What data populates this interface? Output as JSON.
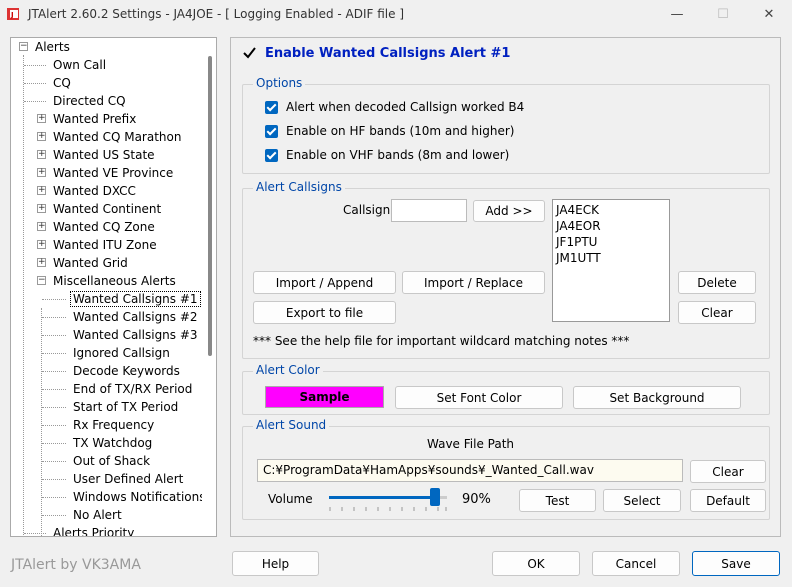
{
  "window": {
    "title": "JTAlert 2.60.2 Settings  -  JA4JOE  -  [ Logging Enabled - ADIF file ]",
    "minimize": "—",
    "maximize": "☐",
    "close": "✕"
  },
  "tree": {
    "root": "Alerts",
    "items": [
      "Own Call",
      "CQ",
      "Directed CQ",
      "Wanted Prefix",
      "Wanted CQ Marathon",
      "Wanted US State",
      "Wanted VE Province",
      "Wanted DXCC",
      "Wanted Continent",
      "Wanted CQ Zone",
      "Wanted ITU Zone",
      "Wanted Grid",
      "Miscellaneous Alerts",
      "Wanted Callsigns #1",
      "Wanted Callsigns #2",
      "Wanted Callsigns #3",
      "Ignored Callsign",
      "Decode Keywords",
      "End of TX/RX Period",
      "Start of TX Period",
      "Rx Frequency",
      "TX Watchdog",
      "Out of Shack",
      "User Defined Alert",
      "Windows Notifications",
      "No Alert",
      "Alerts Priority"
    ]
  },
  "panel": {
    "enable_label": "Enable Wanted Callsigns Alert #1",
    "options": {
      "title": "Options",
      "items": [
        "Alert when decoded Callsign worked B4",
        "Enable on HF bands (10m and higher)",
        "Enable on VHF bands (8m and lower)"
      ]
    },
    "callsigns": {
      "title": "Alert Callsigns",
      "callsign_label": "Callsign",
      "callsign_value": "",
      "add_label": "Add >>",
      "list": [
        "JA4ECK",
        "JA4EOR",
        "JF1PTU",
        "JM1UTT"
      ],
      "import_append": "Import / Append",
      "import_replace": "Import / Replace",
      "export": "Export to file",
      "delete": "Delete",
      "clear": "Clear",
      "note": "***  See the help file for important wildcard matching notes  ***"
    },
    "color": {
      "title": "Alert Color",
      "sample": "Sample",
      "sample_bg": "#ff00ff",
      "set_font": "Set Font Color",
      "set_bg": "Set Background"
    },
    "sound": {
      "title": "Alert Sound",
      "path_label": "Wave File Path",
      "path_value": "C:¥ProgramData¥HamApps¥sounds¥_Wanted_Call.wav",
      "clear": "Clear",
      "volume_label": "Volume",
      "volume_value": "90%",
      "volume_fraction": 0.9,
      "test": "Test",
      "select": "Select",
      "default": "Default"
    }
  },
  "footer": {
    "brand": "JTAlert by VK3AMA",
    "help": "Help",
    "ok": "OK",
    "cancel": "Cancel",
    "save": "Save"
  }
}
